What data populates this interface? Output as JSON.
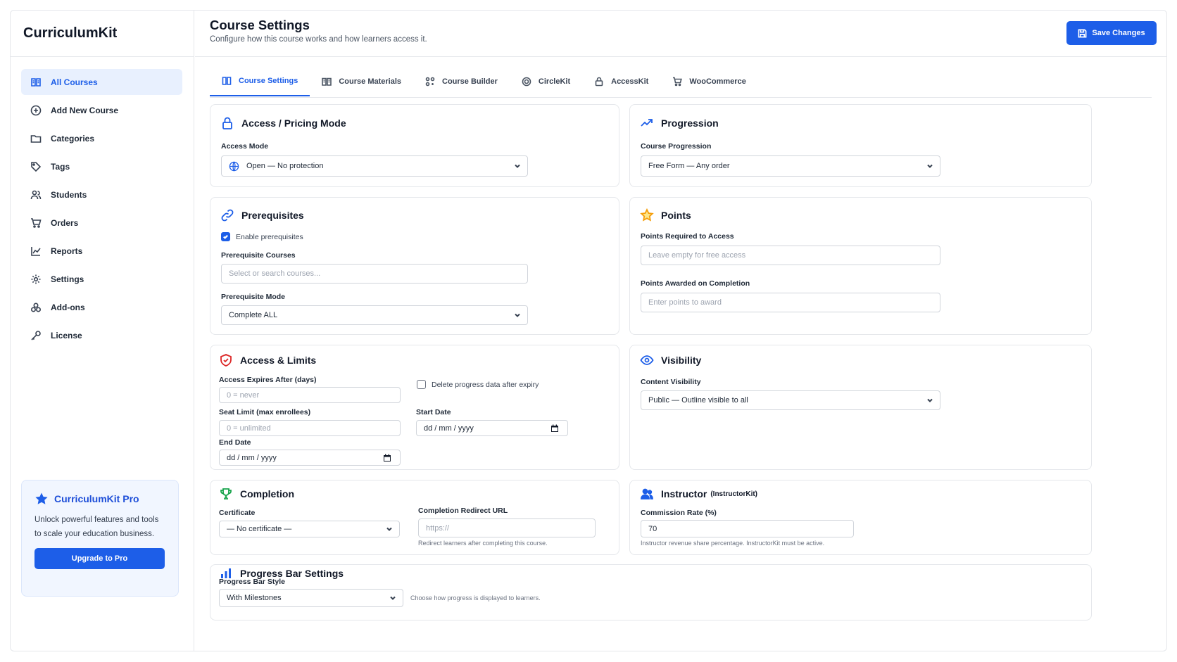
{
  "app": {
    "brand": "CurriculumKit"
  },
  "sidebar": {
    "items": [
      {
        "label": "All Courses",
        "icon": "book-icon",
        "active": true
      },
      {
        "label": "Add New Course",
        "icon": "plus-circle-icon"
      },
      {
        "label": "Categories",
        "icon": "folder-icon"
      },
      {
        "label": "Tags",
        "icon": "tag-icon"
      },
      {
        "label": "Students",
        "icon": "users-icon"
      },
      {
        "label": "Orders",
        "icon": "cart-icon"
      },
      {
        "label": "Reports",
        "icon": "chart-line-icon"
      },
      {
        "label": "Settings",
        "icon": "gear-icon"
      },
      {
        "label": "Add-ons",
        "icon": "puzzle-icon"
      },
      {
        "label": "License",
        "icon": "key-icon"
      }
    ],
    "promo": {
      "title": "CurriculumKit Pro",
      "text": "Unlock powerful features and tools to scale your education business.",
      "button": "Upgrade to Pro"
    }
  },
  "header": {
    "title": "Course Settings",
    "subtitle": "Configure how this course works and how learners access it.",
    "save_label": "Save Changes"
  },
  "tabs": [
    {
      "label": "Course Settings",
      "icon": "book-icon",
      "active": true
    },
    {
      "label": "Course Materials",
      "icon": "book-open-icon"
    },
    {
      "label": "Course Builder",
      "icon": "builder-icon"
    },
    {
      "label": "CircleKit",
      "icon": "circle-icon"
    },
    {
      "label": "AccessKit",
      "icon": "lock-icon"
    },
    {
      "label": "WooCommerce",
      "icon": "cart-icon"
    }
  ],
  "access": {
    "title": "Access / Pricing Mode",
    "mode_label": "Access Mode",
    "mode_value": "Open — No protection"
  },
  "progression": {
    "title": "Progression",
    "label": "Course Progression",
    "value": "Free Form — Any order"
  },
  "prereq": {
    "title": "Prerequisites",
    "enable_label": "Enable prerequisites",
    "enabled": true,
    "courses_label": "Prerequisite Courses",
    "courses_placeholder": "Select or search courses...",
    "mode_label": "Prerequisite Mode",
    "mode_value": "Complete ALL"
  },
  "points": {
    "title": "Points",
    "required_label": "Points Required to Access",
    "required_placeholder": "Leave empty for free access",
    "awarded_label": "Points Awarded on Completion",
    "awarded_placeholder": "Enter points to award"
  },
  "limits": {
    "title": "Access & Limits",
    "expires_label": "Access Expires After (days)",
    "expires_placeholder": "0 = never",
    "delete_label": "Delete progress data after expiry",
    "seat_label": "Seat Limit (max enrollees)",
    "seat_placeholder": "0 = unlimited",
    "start_label": "Start Date",
    "start_placeholder": "dd / mm / yyyy",
    "end_label": "End Date",
    "end_placeholder": "dd / mm / yyyy"
  },
  "visibility": {
    "title": "Visibility",
    "label": "Content Visibility",
    "value": "Public — Outline visible to all"
  },
  "completion": {
    "title": "Completion",
    "cert_label": "Certificate",
    "cert_value": "— No certificate —",
    "redirect_label": "Completion Redirect URL",
    "redirect_placeholder": "https://",
    "redirect_hint": "Redirect learners after completing this course."
  },
  "instructor": {
    "title": "Instructor",
    "title_suffix": "(InstructorKit)",
    "rate_label": "Commission Rate (%)",
    "rate_value": "70",
    "hint": "Instructor revenue share percentage. InstructorKit must be active."
  },
  "progressbar": {
    "title": "Progress Bar Settings",
    "style_label": "Progress Bar Style",
    "style_value": "With Milestones",
    "hint": "Choose how progress is displayed to learners."
  },
  "colors": {
    "accent": "#1d5ee8",
    "danger": "#dc2626",
    "warning": "#f59e0b",
    "success": "#16a34a"
  }
}
